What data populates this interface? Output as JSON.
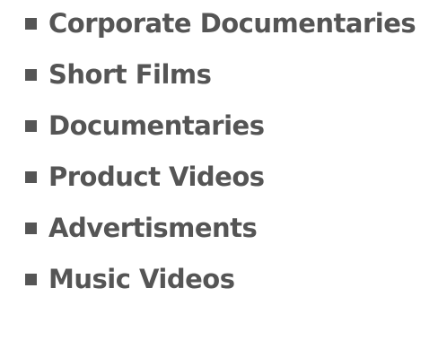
{
  "services": {
    "items": [
      {
        "label": "Corporate Documentaries"
      },
      {
        "label": "Short Films"
      },
      {
        "label": "Documentaries"
      },
      {
        "label": "Product Videos"
      },
      {
        "label": "Advertisments"
      },
      {
        "label": "Music Videos"
      }
    ]
  },
  "colors": {
    "text": "#555555",
    "bullet": "#555555",
    "background": "#ffffff"
  },
  "icons": {
    "bullet": "square-bullet-icon"
  }
}
